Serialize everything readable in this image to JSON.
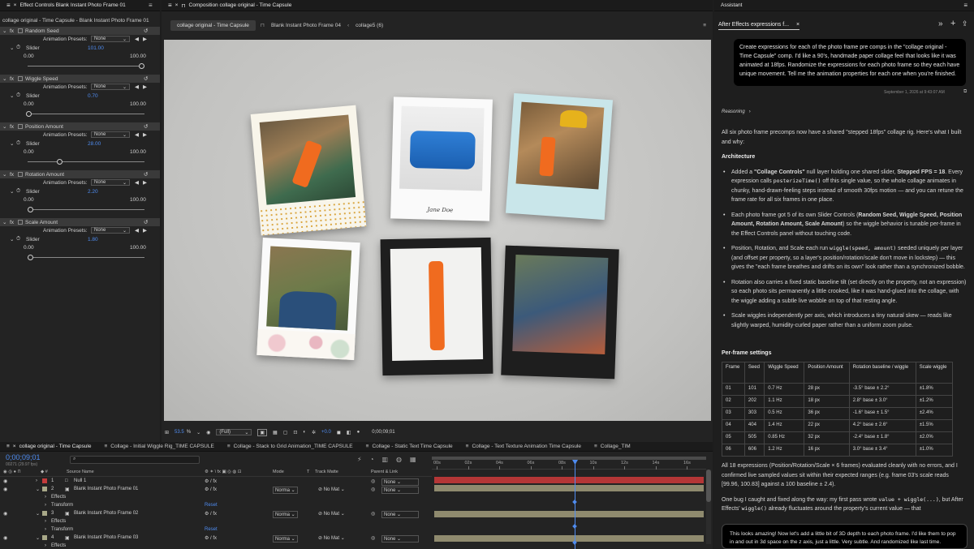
{
  "effect_controls": {
    "tab_title": "Effect Controls Blank Instant Photo Frame 01",
    "subtitle": "collage original - Time Capsule - Blank Instant Photo Frame 01",
    "effects": [
      {
        "name": "Random Seed",
        "presets_label": "Animation Presets:",
        "preset": "None",
        "slider_label": "Slider",
        "value": "101.00",
        "min": "0.00",
        "max": "100.00",
        "frac": 1.0
      },
      {
        "name": "Wiggle Speed",
        "presets_label": "Animation Presets:",
        "preset": "None",
        "slider_label": "Slider",
        "value": "0.70",
        "min": "0.00",
        "max": "100.00",
        "frac": 0.007
      },
      {
        "name": "Position Amount",
        "presets_label": "Animation Presets:",
        "preset": "None",
        "slider_label": "Slider",
        "value": "28.00",
        "min": "0.00",
        "max": "100.00",
        "frac": 0.28
      },
      {
        "name": "Rotation Amount",
        "presets_label": "Animation Presets:",
        "preset": "None",
        "slider_label": "Slider",
        "value": "2.20",
        "min": "0.00",
        "max": "100.00",
        "frac": 0.022
      },
      {
        "name": "Scale Amount",
        "presets_label": "Animation Presets:",
        "preset": "None",
        "slider_label": "Slider",
        "value": "1.80",
        "min": "0.00",
        "max": "100.00",
        "frac": 0.018
      }
    ]
  },
  "composition": {
    "tab_title": "Composition collage original - Time Capsule",
    "tabs": [
      "collage original - Time Capsule",
      "Blank Instant Photo Frame 04",
      "collage5 (6)"
    ],
    "signature": "Jane Doe",
    "zoom": "53.5",
    "zoom_unit": "%",
    "resolution": "(Full)",
    "exposure": "+0.0",
    "timecode": "0;00;09;01"
  },
  "timeline": {
    "tabs": [
      "collage original - Time Capsule",
      "Collage - Initial Wiggle Rig_TIME CAPSULE",
      "Collage - Stack to Grid Animation_TIME CAPSULE",
      "Collage - Static Text Time Capsule",
      "Collage - Text Texture Animation Time Capsule",
      "Collage_TIM"
    ],
    "timecode": "0;00;09;01",
    "timecode_sub": "00271 (29.97 fps)",
    "columns": {
      "source": "Source Name",
      "mode": "Mode",
      "t": "T",
      "track": "Track Matte",
      "parent": "Parent & Link"
    },
    "ruler": [
      "00s",
      "02s",
      "04s",
      "06s",
      "08s",
      "10s",
      "12s",
      "14s",
      "16s"
    ],
    "layers": [
      {
        "num": "1",
        "name": "Null 1",
        "mode": "",
        "track": "",
        "parent": "None"
      },
      {
        "num": "2",
        "name": "Blank Instant Photo Frame 01",
        "mode": "Norma",
        "track": "No Mat",
        "parent": "None"
      },
      {
        "num": "",
        "name": "Effects",
        "mode": "",
        "track": "",
        "parent": ""
      },
      {
        "num": "",
        "name": "Transform",
        "mode": "",
        "track": "",
        "parent": "",
        "reset": "Reset"
      },
      {
        "num": "3",
        "name": "Blank Instant Photo Frame 02",
        "mode": "Norma",
        "track": "No Mat",
        "parent": "None"
      },
      {
        "num": "",
        "name": "Effects",
        "mode": "",
        "track": "",
        "parent": ""
      },
      {
        "num": "",
        "name": "Transform",
        "mode": "",
        "track": "",
        "parent": "",
        "reset": "Reset"
      },
      {
        "num": "4",
        "name": "Blank Instant Photo Frame 03",
        "mode": "Norma",
        "track": "No Mat",
        "parent": "None"
      },
      {
        "num": "",
        "name": "Effects",
        "mode": "",
        "track": "",
        "parent": ""
      }
    ]
  },
  "assistant": {
    "panel_title": "Assistant",
    "tab": "After Effects expressions f...",
    "user_message": "Create expressions for each of the photo frame pre comps in the \"collage original - Time Capsule\" comp. I'd like a 90's, handmade paper collage feel that looks like it was animated at 18fps. Randomize the expressions for each photo frame so they each have unique movement. Tell me the animation properties for each one when you're finished.",
    "timestamp": "September 1, 2026 at 9:43:07 AM",
    "reasoning": "Reasoning",
    "intro": "All six photo frame precomps now have a shared \"stepped 18fps\" collage rig. Here's what I built and why:",
    "architecture_heading": "Architecture",
    "b1_pre": "Added a ",
    "b1_bold1": "\"Collage Controls\"",
    "b1_mid": " null layer holding one shared slider, ",
    "b1_bold2": "Stepped FPS = 18",
    "b1_mid2": ". Every expression calls ",
    "b1_code": "posterizeTime()",
    "b1_post": " off this single value, so the whole collage animates in chunky, hand-drawn-feeling steps instead of smooth 30fps motion — and you can retune the frame rate for all six frames in one place.",
    "b2_pre": "Each photo frame got 5 of its own Slider Controls (",
    "b2_bold": "Random Seed, Wiggle Speed, Position Amount, Rotation Amount, Scale Amount",
    "b2_post": ") so the wiggle behavior is tunable per-frame in the Effect Controls panel without touching code.",
    "b3_pre": "Position, Rotation, and Scale each run ",
    "b3_code": "wiggle(speed, amount)",
    "b3_post": " seeded uniquely per layer (and offset per property, so a layer's position/rotation/scale don't move in lockstep) — this gives the \"each frame breathes and drifts on its own\" look rather than a synchronized bobble.",
    "b4": "Rotation also carries a fixed static baseline tilt (set directly on the property, not an expression) so each photo sits permanently a little crooked, like it was hand-glued into the collage, with the wiggle adding a subtle live wobble on top of that resting angle.",
    "b5": "Scale wiggles independently per axis, which introduces a tiny natural skew — reads like slightly warped, humidity-curled paper rather than a uniform zoom pulse.",
    "per_frame_heading": "Per-frame settings",
    "table_headers": [
      "Frame",
      "Seed",
      "Wiggle Speed",
      "Position Amount",
      "Rotation baseline / wiggle",
      "Scale wiggle"
    ],
    "table_rows": [
      [
        "01",
        "101",
        "0.7 Hz",
        "28 px",
        "-3.5° base ± 2.2°",
        "±1.8%"
      ],
      [
        "02",
        "202",
        "1.1 Hz",
        "18 px",
        "2.8° base ± 3.0°",
        "±1.2%"
      ],
      [
        "03",
        "303",
        "0.5 Hz",
        "36 px",
        "-1.6° base ± 1.5°",
        "±2.4%"
      ],
      [
        "04",
        "404",
        "1.4 Hz",
        "22 px",
        "4.2° base ± 2.6°",
        "±1.5%"
      ],
      [
        "05",
        "505",
        "0.85 Hz",
        "32 px",
        "-2.4° base ± 1.8°",
        "±2.0%"
      ],
      [
        "06",
        "606",
        "1.2 Hz",
        "16 px",
        "3.0° base ± 3.4°",
        "±1.0%"
      ]
    ],
    "after_table": "All 18 expressions (Position/Rotation/Scale × 6 frames) evaluated cleanly with no errors, and I confirmed live sampled values sit within their expected ranges (e.g. frame 03's scale reads [99.96, 100.83] against a 100 baseline ± 2.4).",
    "bug_pre": "One bug I caught and fixed along the way: my first pass wrote ",
    "bug_code1": "value + wiggle(...)",
    "bug_mid": ", but After Effects' ",
    "bug_code2": "wiggle()",
    "bug_post": " already fluctuates around the property's current value — that",
    "input_text": "This looks amazing! Now let's add a little bit of 3D depth to each photo frame. I'd like them to pop in and out in 3d space on the z axis, just a little. Very subtle. And randomized like last time."
  },
  "colors": {
    "accent": "#4f8cf0",
    "panel": "#232323",
    "background": "#1d1d1d",
    "playhead": "#4f8cf0"
  }
}
